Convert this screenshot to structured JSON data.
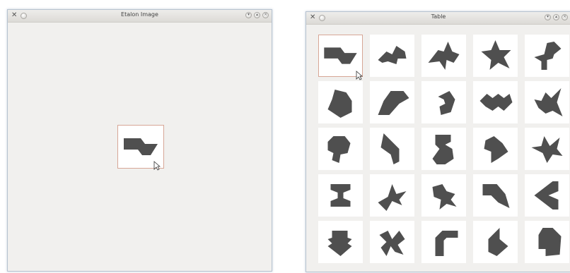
{
  "etalon": {
    "title": "Etalon Image",
    "target_shape": "piece-zigzag-shape"
  },
  "table": {
    "title": "Table",
    "rows": 5,
    "cols": 5,
    "selected_index": 0,
    "cells": [
      "piece-zigzag-shape",
      "piece-arrow-shape",
      "piece-bird-shape",
      "piece-star-shape",
      "piece-step-shape",
      "piece-head-shape",
      "piece-boot-shape",
      "piece-hook-shape",
      "piece-bat-shape",
      "piece-fox-shape",
      "piece-key-shape",
      "piece-chevron-shape",
      "piece-stool-shape",
      "piece-heart-shape",
      "piece-cross-shape",
      "piece-hourglass-shape",
      "piece-pinwheel-shape",
      "piece-runner-shape",
      "piece-flag-shape",
      "piece-left-arrow-shape",
      "piece-down-arrow-shape",
      "piece-spiral-shape",
      "piece-corner-shape",
      "piece-diamond-shape",
      "piece-house-shape"
    ]
  },
  "colors": {
    "piece": "#4f4f4f",
    "selection_border": "#d7a696",
    "window_border": "#b7c3d0"
  },
  "icons": {
    "app": "close-x-icon",
    "window_buttons": [
      "minimize-icon",
      "maximize-icon",
      "close-icon"
    ]
  }
}
